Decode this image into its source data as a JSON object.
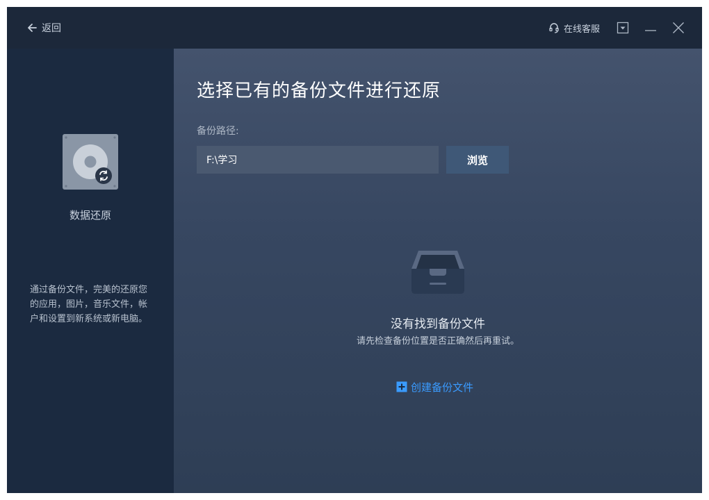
{
  "header": {
    "back_label": "返回",
    "service_label": "在线客服",
    "icons": [
      "arrow-left-icon",
      "headset-icon",
      "dropdown-icon",
      "minimize-icon",
      "close-icon"
    ]
  },
  "sidebar": {
    "icon": "disk-restore-icon",
    "title": "数据还原",
    "description": "通过备份文件，完美的还原您的应用，图片，音乐文件，帐户和设置到新系统或新电脑。"
  },
  "main": {
    "title": "选择已有的备份文件进行还原",
    "path_label": "备份路径:",
    "path_value": "F:\\学习",
    "browse_label": "浏览",
    "empty": {
      "icon": "empty-tray-icon",
      "title": "没有找到备份文件",
      "subtitle": "请先检查备份位置是否正确然后再重试。"
    },
    "create_label": "创建备份文件",
    "create_icon": "plus-square-icon"
  },
  "colors": {
    "titlebar": "#1c283a",
    "sidebar": "#1b2a40",
    "main_top": "#44536d",
    "main_bottom": "#2e3e55",
    "accent_link": "#3a9bff",
    "button": "#3f5877"
  }
}
